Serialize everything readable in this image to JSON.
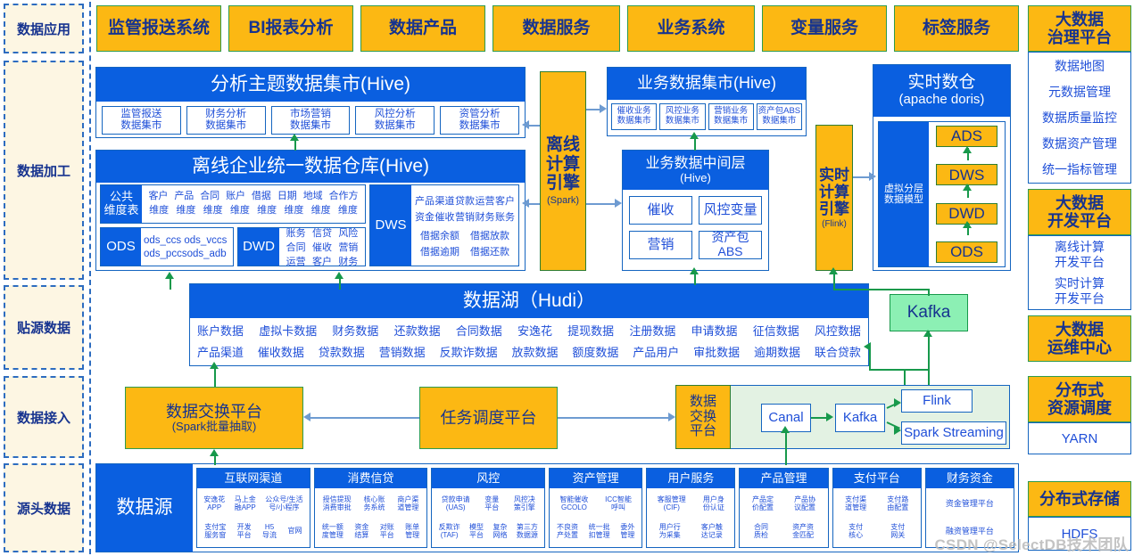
{
  "lanes": [
    {
      "label": "数据应用"
    },
    {
      "label": "数据加工"
    },
    {
      "label": "贴源数据"
    },
    {
      "label": "数据接入"
    },
    {
      "label": "源头数据"
    }
  ],
  "apps": [
    {
      "label": "监管报送系统"
    },
    {
      "label": "BI报表分析"
    },
    {
      "label": "数据产品"
    },
    {
      "label": "数据服务"
    },
    {
      "label": "业务系统"
    },
    {
      "label": "变量服务"
    },
    {
      "label": "标签服务"
    }
  ],
  "analysis_mart": {
    "title": "分析主题数据集市(Hive)",
    "items": [
      {
        "l1": "监管报送",
        "l2": "数据集市"
      },
      {
        "l1": "财务分析",
        "l2": "数据集市"
      },
      {
        "l1": "市场营销",
        "l2": "数据集市"
      },
      {
        "l1": "风控分析",
        "l2": "数据集市"
      },
      {
        "l1": "资管分析",
        "l2": "数据集市"
      }
    ]
  },
  "offline_engine": {
    "title": "离线\n计算\n引擎",
    "lines": [
      "离线",
      "计算",
      "引擎"
    ],
    "sub": "(Spark)"
  },
  "realtime_engine": {
    "lines": [
      "实时",
      "计算",
      "引擎"
    ],
    "sub": "(Flink)"
  },
  "business_mart": {
    "title": "业务数据集市(Hive)",
    "items": [
      {
        "l1": "催收业务",
        "l2": "数据集市"
      },
      {
        "l1": "风控业务",
        "l2": "数据集市"
      },
      {
        "l1": "营销业务",
        "l2": "数据集市"
      },
      {
        "l1": "资产包ABS",
        "l2": "数据集市"
      }
    ]
  },
  "business_mid": {
    "title": "业务数据中间层",
    "subtitle": "(Hive)",
    "items": [
      "催收",
      "风控变量",
      "营销",
      "资产包\nABS"
    ],
    "item_labels": [
      {
        "t": "催收"
      },
      {
        "t": "风控变量"
      },
      {
        "t": "营销"
      },
      {
        "t": "资产包 ABS",
        "l1": "资产包",
        "l2": "ABS"
      }
    ]
  },
  "realtime_dw": {
    "title": "实时数仓",
    "subtitle": "(apache doris)",
    "model_label": "虚拟分层\n数据模型",
    "model_l1": "虚拟分层",
    "model_l2": "数据模型",
    "layers": [
      "ADS",
      "DWS",
      "DWD",
      "ODS"
    ]
  },
  "offline_dw": {
    "title": "离线企业统一数据仓库(Hive)",
    "dim_label_l1": "公共",
    "dim_label_l2": "维度表",
    "dims_row1": [
      "客户",
      "产品",
      "合同",
      "账户",
      "借据",
      "日期",
      "地域",
      "合作方"
    ],
    "dims_row2": [
      "维度",
      "维度",
      "维度",
      "维度",
      "维度",
      "维度",
      "维度",
      "维度"
    ],
    "ods_label": "ODS",
    "ods_items": [
      "ods_ccs",
      "ods_vccs",
      "ods_pccsods_adb"
    ],
    "ods_row1": "ods_ccs  ods_vccs",
    "ods_row2": "ods_pccsods_adb",
    "dwd_label": "DWD",
    "dwd_items": [
      "账务",
      "信贷",
      "风险",
      "合同",
      "催收",
      "营销",
      "运营",
      "客户",
      "财务"
    ],
    "dws_label": "DWS",
    "dws_row1": [
      "产品",
      "渠道",
      "贷款",
      "运营",
      "客户"
    ],
    "dws_row2": [
      "资金",
      "催收",
      "营销",
      "财务",
      "账务"
    ],
    "dws_row3": [
      "借据余额",
      "借据放款"
    ],
    "dws_row4": [
      "借据逾期",
      "借据还款"
    ]
  },
  "data_lake": {
    "title": "数据湖（Hudi）",
    "row1": [
      "账户数据",
      "虚拟卡数据",
      "财务数据",
      "还款数据",
      "合同数据",
      "安逸花",
      "提现数据",
      "注册数据",
      "申请数据",
      "征信数据",
      "风控数据"
    ],
    "row2": [
      "产品渠道",
      "催收数据",
      "贷款数据",
      "营销数据",
      "反欺诈数据",
      "放款数据",
      "额度数据",
      "产品用户",
      "审批数据",
      "逾期数据",
      "联合贷款"
    ]
  },
  "kafka_standalone": {
    "label": "Kafka"
  },
  "exchange_platform": {
    "title": "数据交换平台",
    "sub": "(Spark批量抽取)"
  },
  "scheduler": {
    "label": "任务调度平台"
  },
  "exchange_rt": {
    "lines": [
      "数据",
      "交换",
      "平台"
    ]
  },
  "stream_chain": {
    "canal": "Canal",
    "kafka": "Kafka",
    "flink": "Flink",
    "spark_streaming": "Spark Streaming"
  },
  "source": {
    "title": "数据源",
    "groups": [
      {
        "name": "互联网渠道",
        "row1": [
          {
            "l1": "安逸花",
            "l2": "APP"
          },
          {
            "l1": "马上金",
            "l2": "融APP"
          },
          {
            "l1": "公众号/生活",
            "l2": "号/小程序"
          }
        ],
        "row2": [
          {
            "l1": "支付宝",
            "l2": "服务窗"
          },
          {
            "l1": "开发",
            "l2": "平台"
          },
          {
            "l1": "H5",
            "l2": "导流"
          },
          {
            "l1": "官网",
            "l2": ""
          }
        ]
      },
      {
        "name": "消费信贷",
        "row1": [
          {
            "l1": "授信提现",
            "l2": "消费审批"
          },
          {
            "l1": "核心账",
            "l2": "务系统"
          },
          {
            "l1": "商户渠",
            "l2": "道管理"
          }
        ],
        "row2": [
          {
            "l1": "统一额",
            "l2": "度管理"
          },
          {
            "l1": "资金",
            "l2": "结算"
          },
          {
            "l1": "对账",
            "l2": "平台"
          },
          {
            "l1": "账单",
            "l2": "管理"
          }
        ]
      },
      {
        "name": "风控",
        "row1": [
          {
            "l1": "贷款申请",
            "l2": "(UAS)"
          },
          {
            "l1": "变量",
            "l2": "平台"
          },
          {
            "l1": "风控决",
            "l2": "策引擎"
          }
        ],
        "row2": [
          {
            "l1": "反欺诈",
            "l2": "(TAF)"
          },
          {
            "l1": "模型",
            "l2": "平台"
          },
          {
            "l1": "复杂",
            "l2": "网络"
          },
          {
            "l1": "第三方",
            "l2": "数据源"
          }
        ]
      },
      {
        "name": "资产管理",
        "row1": [
          {
            "l1": "智能催收",
            "l2": "GCOLO"
          },
          {
            "l1": "ICC智能",
            "l2": "呼叫"
          }
        ],
        "row2": [
          {
            "l1": "不良资",
            "l2": "产处置"
          },
          {
            "l1": "统一批",
            "l2": "扣管理"
          },
          {
            "l1": "委外",
            "l2": "管理"
          }
        ]
      },
      {
        "name": "用户服务",
        "row1": [
          {
            "l1": "客服管理",
            "l2": "(CIF)"
          },
          {
            "l1": "用户身",
            "l2": "份认证"
          }
        ],
        "row2": [
          {
            "l1": "用户行",
            "l2": "为采集"
          },
          {
            "l1": "客户触",
            "l2": "达记录"
          }
        ]
      },
      {
        "name": "产品管理",
        "row1": [
          {
            "l1": "产品定",
            "l2": "价配置"
          },
          {
            "l1": "产品协",
            "l2": "议配置"
          }
        ],
        "row2": [
          {
            "l1": "合同",
            "l2": "质检"
          },
          {
            "l1": "资产资",
            "l2": "金匹配"
          }
        ]
      },
      {
        "name": "支付平台",
        "row1": [
          {
            "l1": "支付渠",
            "l2": "道管理"
          },
          {
            "l1": "支付路",
            "l2": "由配置"
          }
        ],
        "row2": [
          {
            "l1": "支付",
            "l2": "核心"
          },
          {
            "l1": "支付",
            "l2": "网关"
          }
        ]
      },
      {
        "name": "财务资金",
        "row1": [
          {
            "l1": "资金管理平台",
            "l2": ""
          }
        ],
        "row2": [
          {
            "l1": "融资管理平台",
            "l2": ""
          }
        ]
      }
    ]
  },
  "right_rail": {
    "governance": {
      "title_l1": "大数据",
      "title_l2": "治理平台",
      "items": [
        "数据地图",
        "元数据管理",
        "数据质量监控",
        "数据资产管理",
        "统一指标管理"
      ]
    },
    "dev": {
      "title_l1": "大数据",
      "title_l2": "开发平台",
      "items": [
        {
          "l1": "离线计算",
          "l2": "开发平台"
        },
        {
          "l1": "实时计算",
          "l2": "开发平台"
        }
      ]
    },
    "ops": {
      "title_l1": "大数据",
      "title_l2": "运维中心"
    },
    "resource": {
      "title_l1": "分布式",
      "title_l2": "资源调度",
      "item": "YARN"
    },
    "storage": {
      "title": "分布式存储",
      "item": "HDFS"
    }
  },
  "watermark": "CSDN @SelectDB技术团队",
  "colors": {
    "orange": "#FCB813",
    "blue": "#0A5FE0",
    "green_border": "#2E9B4E",
    "lane_bg": "#FDF6E3",
    "kafka_green": "#8CF0B4"
  }
}
